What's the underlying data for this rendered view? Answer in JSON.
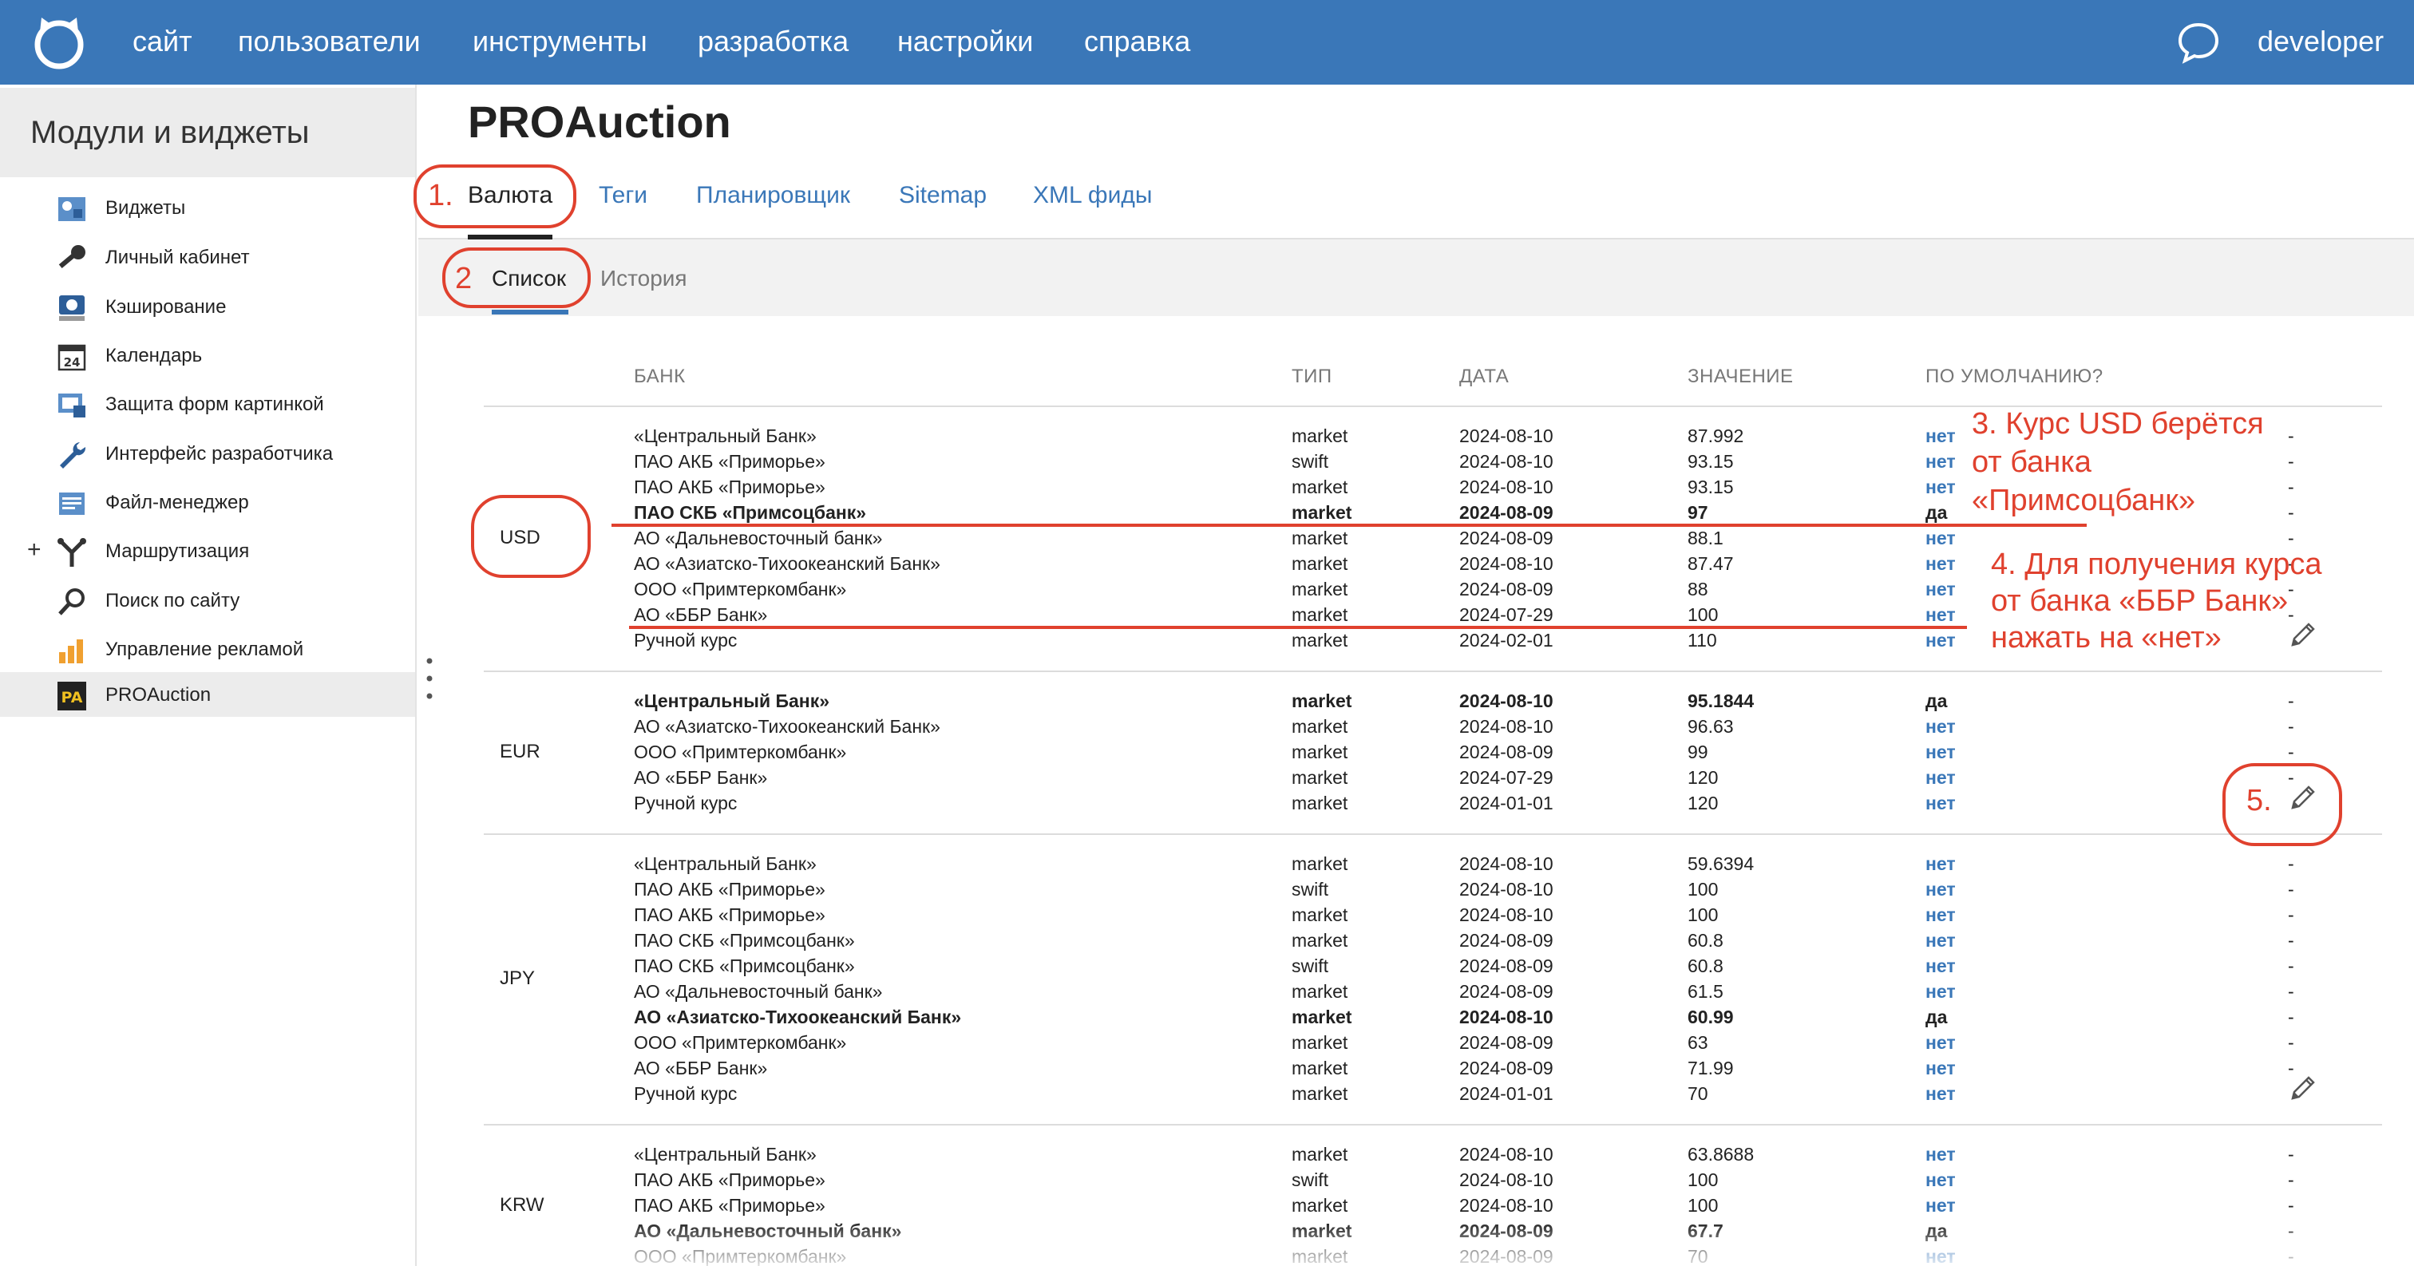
{
  "topnav": {
    "items": [
      "сайт",
      "пользователи",
      "инструменты",
      "разработка",
      "настройки",
      "справка"
    ],
    "user": "developer"
  },
  "sidebar": {
    "title": "Модули и виджеты",
    "items": [
      {
        "label": "Виджеты",
        "icon": "widgets-icon"
      },
      {
        "label": "Личный кабинет",
        "icon": "key-icon"
      },
      {
        "label": "Кэширование",
        "icon": "disk-icon"
      },
      {
        "label": "Календарь",
        "icon": "calendar-icon"
      },
      {
        "label": "Защита форм картинкой",
        "icon": "captcha-icon"
      },
      {
        "label": "Интерфейс разработчика",
        "icon": "wrench-icon"
      },
      {
        "label": "Файл-менеджер",
        "icon": "file-manager-icon"
      },
      {
        "label": "Маршрутизация",
        "icon": "routing-icon"
      },
      {
        "label": "Поиск по сайту",
        "icon": "search-icon"
      },
      {
        "label": "Управление рекламой",
        "icon": "ads-chart-icon"
      },
      {
        "label": "PROAuction",
        "icon": "proauction-icon"
      }
    ],
    "calendar_day": "24",
    "pa_badge": "PA",
    "expand_symbol": "+"
  },
  "page": {
    "title": "PROAuction",
    "tabs": [
      "Валюта",
      "Теги",
      "Планировщик",
      "Sitemap",
      "XML фиды"
    ],
    "subtabs": [
      "Список",
      "История"
    ]
  },
  "table": {
    "headers": [
      "БАНК",
      "ТИП",
      "ДАТА",
      "ЗНАЧЕНИЕ",
      "ПО УМОЛЧАНИЮ?"
    ],
    "groups": [
      {
        "currency": "USD",
        "rows": [
          {
            "bank": "«Центральный Банк»",
            "type": "market",
            "date": "2024-08-10",
            "value": "87.992",
            "default": "нет",
            "action": "-"
          },
          {
            "bank": "ПАО АКБ «Приморье»",
            "type": "swift",
            "date": "2024-08-10",
            "value": "93.15",
            "default": "нет",
            "action": "-"
          },
          {
            "bank": "ПАО АКБ «Приморье»",
            "type": "market",
            "date": "2024-08-10",
            "value": "93.15",
            "default": "нет",
            "action": "-"
          },
          {
            "bank": "ПАО СКБ «Примсоцбанк»",
            "type": "market",
            "date": "2024-08-09",
            "value": "97",
            "default": "да",
            "action": "-",
            "bold": true
          },
          {
            "bank": "АО «Дальневосточный банк»",
            "type": "market",
            "date": "2024-08-09",
            "value": "88.1",
            "default": "нет",
            "action": "-"
          },
          {
            "bank": "АО «Азиатско-Тихоокеанский Банк»",
            "type": "market",
            "date": "2024-08-10",
            "value": "87.47",
            "default": "нет",
            "action": "-"
          },
          {
            "bank": "ООО «Примтеркомбанк»",
            "type": "market",
            "date": "2024-08-09",
            "value": "88",
            "default": "нет",
            "action": "-"
          },
          {
            "bank": "АО «ББР Банк»",
            "type": "market",
            "date": "2024-07-29",
            "value": "100",
            "default": "нет",
            "action": "-"
          },
          {
            "bank": "Ручной курс",
            "type": "market",
            "date": "2024-02-01",
            "value": "110",
            "default": "нет",
            "action": ""
          }
        ]
      },
      {
        "currency": "EUR",
        "rows": [
          {
            "bank": "«Центральный Банк»",
            "type": "market",
            "date": "2024-08-10",
            "value": "95.1844",
            "default": "да",
            "action": "-",
            "bold": true
          },
          {
            "bank": "АО «Азиатско-Тихоокеанский Банк»",
            "type": "market",
            "date": "2024-08-10",
            "value": "96.63",
            "default": "нет",
            "action": "-"
          },
          {
            "bank": "ООО «Примтеркомбанк»",
            "type": "market",
            "date": "2024-08-09",
            "value": "99",
            "default": "нет",
            "action": "-"
          },
          {
            "bank": "АО «ББР Банк»",
            "type": "market",
            "date": "2024-07-29",
            "value": "120",
            "default": "нет",
            "action": "-"
          },
          {
            "bank": "Ручной курс",
            "type": "market",
            "date": "2024-01-01",
            "value": "120",
            "default": "нет",
            "action": ""
          }
        ]
      },
      {
        "currency": "JPY",
        "rows": [
          {
            "bank": "«Центральный Банк»",
            "type": "market",
            "date": "2024-08-10",
            "value": "59.6394",
            "default": "нет",
            "action": "-"
          },
          {
            "bank": "ПАО АКБ «Приморье»",
            "type": "swift",
            "date": "2024-08-10",
            "value": "100",
            "default": "нет",
            "action": "-"
          },
          {
            "bank": "ПАО АКБ «Приморье»",
            "type": "market",
            "date": "2024-08-10",
            "value": "100",
            "default": "нет",
            "action": "-"
          },
          {
            "bank": "ПАО СКБ «Примсоцбанк»",
            "type": "market",
            "date": "2024-08-09",
            "value": "60.8",
            "default": "нет",
            "action": "-"
          },
          {
            "bank": "ПАО СКБ «Примсоцбанк»",
            "type": "swift",
            "date": "2024-08-09",
            "value": "60.8",
            "default": "нет",
            "action": "-"
          },
          {
            "bank": "АО «Дальневосточный банк»",
            "type": "market",
            "date": "2024-08-09",
            "value": "61.5",
            "default": "нет",
            "action": "-"
          },
          {
            "bank": "АО «Азиатско-Тихоокеанский Банк»",
            "type": "market",
            "date": "2024-08-10",
            "value": "60.99",
            "default": "да",
            "action": "-",
            "bold": true
          },
          {
            "bank": "ООО «Примтеркомбанк»",
            "type": "market",
            "date": "2024-08-09",
            "value": "63",
            "default": "нет",
            "action": "-"
          },
          {
            "bank": "АО «ББР Банк»",
            "type": "market",
            "date": "2024-08-09",
            "value": "71.99",
            "default": "нет",
            "action": "-"
          },
          {
            "bank": "Ручной курс",
            "type": "market",
            "date": "2024-01-01",
            "value": "70",
            "default": "нет",
            "action": ""
          }
        ]
      },
      {
        "currency": "KRW",
        "rows": [
          {
            "bank": "«Центральный Банк»",
            "type": "market",
            "date": "2024-08-10",
            "value": "63.8688",
            "default": "нет",
            "action": "-"
          },
          {
            "bank": "ПАО АКБ «Приморье»",
            "type": "swift",
            "date": "2024-08-10",
            "value": "100",
            "default": "нет",
            "action": "-"
          },
          {
            "bank": "ПАО АКБ «Приморье»",
            "type": "market",
            "date": "2024-08-10",
            "value": "100",
            "default": "нет",
            "action": "-"
          },
          {
            "bank": "АО «Дальневосточный банк»",
            "type": "market",
            "date": "2024-08-09",
            "value": "67.7",
            "default": "да",
            "action": "-",
            "bold": true
          },
          {
            "bank": "ООО «Примтеркомбанк»",
            "type": "market",
            "date": "2024-08-09",
            "value": "70",
            "default": "нет",
            "action": "-"
          }
        ]
      }
    ]
  },
  "annotations": {
    "step1": "1.",
    "step2": "2",
    "step3": [
      "3. Курс USD берётся",
      "от банка",
      "«Примсоцбанк»"
    ],
    "step4": [
      "4. Для получения курса",
      "от банка «ББР Банк»",
      "нажать на «нет»"
    ],
    "step5": "5.",
    "color": "#e0412e"
  },
  "colors": {
    "topbar": "#3a77b8",
    "link": "#3a77b8"
  }
}
